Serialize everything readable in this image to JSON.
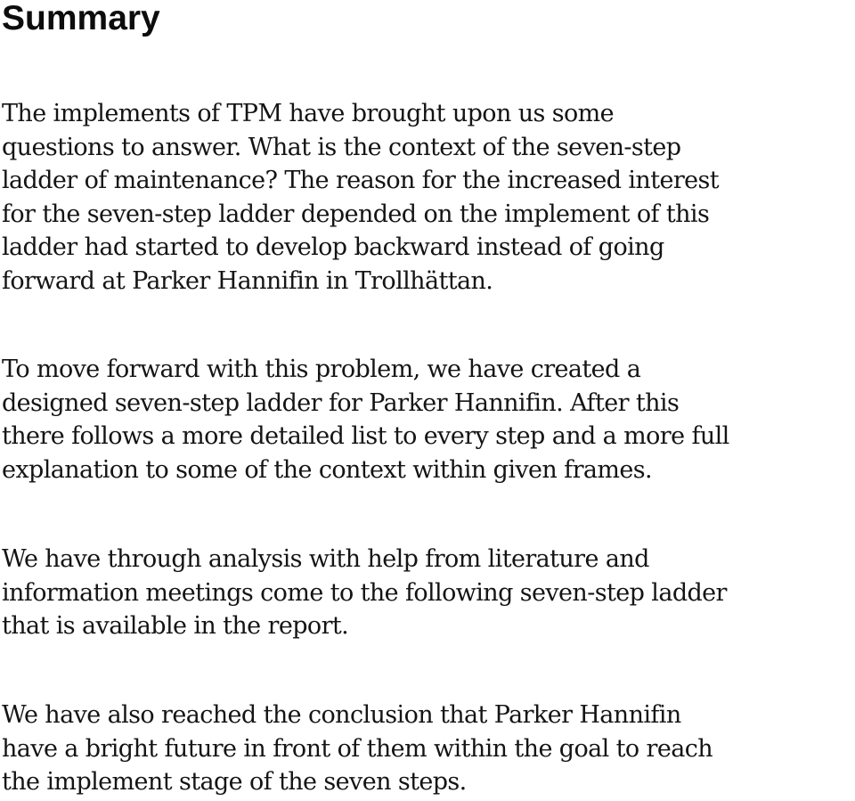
{
  "heading": "Summary",
  "paragraphs": [
    {
      "lines": [
        "The  implements of TPM have brought upon us some",
        "questions to answer. What is the context of the seven-step",
        "ladder of maintenance? The reason for the increased interest",
        "for the seven-step ladder depended on the implement of this",
        "ladder had started to develop backward instead of going",
        "forward at Parker Hannifin in Trollhättan."
      ]
    },
    {
      "lines": [
        "To move forward with this problem, we have created a",
        "designed seven-step ladder for Parker Hannifin. After this",
        "there follows a more detailed list to every step and a more full",
        "explanation to some of the context within given frames."
      ]
    },
    {
      "lines": [
        "We have through analysis with help from literature and",
        "information meetings come to the following seven-step ladder",
        "that is available in the report."
      ]
    },
    {
      "lines": [
        "We have also reached the conclusion that Parker Hannifin",
        "have a bright future in front of them within the goal to reach",
        "the implement stage of the seven steps."
      ]
    }
  ]
}
